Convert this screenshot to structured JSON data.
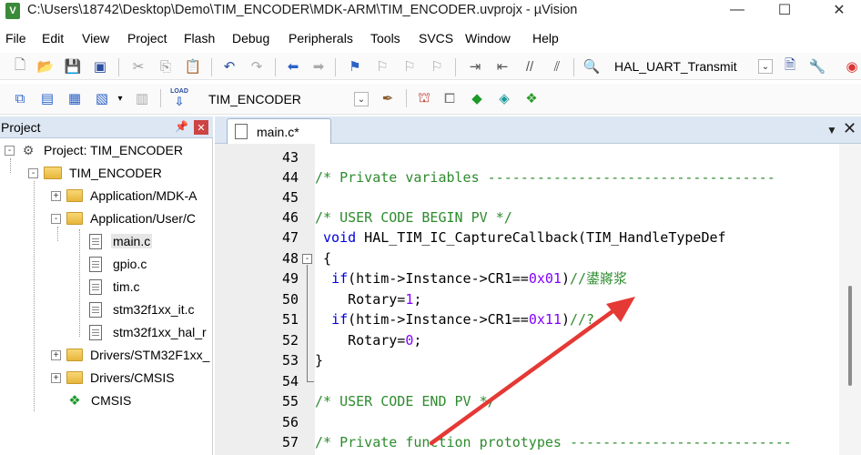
{
  "window": {
    "title": "C:\\Users\\18742\\Desktop\\Demo\\TIM_ENCODER\\MDK-ARM\\TIM_ENCODER.uvprojx - µVision",
    "app_icon": "V"
  },
  "menu": [
    "File",
    "Edit",
    "View",
    "Project",
    "Flash",
    "Debug",
    "Peripherals",
    "Tools",
    "SVCS",
    "Window",
    "Help"
  ],
  "toolbar1": {
    "find_combo_value": "HAL_UART_Transmit"
  },
  "toolbar2": {
    "target_combo_value": "TIM_ENCODER",
    "load_label": "LOAD"
  },
  "project_panel": {
    "title": "Project",
    "tree": [
      {
        "label": "Project: TIM_ENCODER",
        "type": "project",
        "expander": "-"
      },
      {
        "label": "TIM_ENCODER",
        "type": "target",
        "expander": "-"
      },
      {
        "label": "Application/MDK-A",
        "type": "folder",
        "expander": "+"
      },
      {
        "label": "Application/User/C",
        "type": "folder",
        "expander": "-"
      },
      {
        "label": "main.c",
        "type": "file",
        "selected": true
      },
      {
        "label": "gpio.c",
        "type": "file"
      },
      {
        "label": "tim.c",
        "type": "file"
      },
      {
        "label": "stm32f1xx_it.c",
        "type": "file"
      },
      {
        "label": "stm32f1xx_hal_r",
        "type": "file"
      },
      {
        "label": "Drivers/STM32F1xx_",
        "type": "folder",
        "expander": "+"
      },
      {
        "label": "Drivers/CMSIS",
        "type": "folder",
        "expander": "+"
      },
      {
        "label": "CMSIS",
        "type": "component"
      }
    ]
  },
  "editor": {
    "active_tab": "main.c*",
    "lines": [
      {
        "no": "43",
        "parts": []
      },
      {
        "no": "44",
        "parts": [
          {
            "t": "/* Private variables -----------------------------------",
            "c": "comment"
          }
        ]
      },
      {
        "no": "45",
        "parts": []
      },
      {
        "no": "46",
        "parts": [
          {
            "t": "/* USER CODE BEGIN PV */",
            "c": "comment"
          }
        ]
      },
      {
        "no": "47",
        "parts": [
          {
            "t": " ",
            "c": "plain"
          },
          {
            "t": "void",
            "c": "kw"
          },
          {
            "t": " HAL_TIM_IC_CaptureCallback(TIM_HandleTypeDef",
            "c": "plain"
          }
        ]
      },
      {
        "no": "48",
        "parts": [
          {
            "t": " {",
            "c": "plain"
          }
        ],
        "fold": "-"
      },
      {
        "no": "49",
        "parts": [
          {
            "t": "  ",
            "c": "plain"
          },
          {
            "t": "if",
            "c": "kw"
          },
          {
            "t": "(htim->Instance->CR1==",
            "c": "plain"
          },
          {
            "t": "0x01",
            "c": "num"
          },
          {
            "t": ")",
            "c": "plain"
          },
          {
            "t": "//",
            "c": "comment"
          },
          {
            "t": "鍙嶈浆",
            "c": "cjk"
          }
        ]
      },
      {
        "no": "50",
        "parts": [
          {
            "t": "    Rotary=",
            "c": "plain"
          },
          {
            "t": "1",
            "c": "num"
          },
          {
            "t": ";",
            "c": "plain"
          }
        ]
      },
      {
        "no": "51",
        "parts": [
          {
            "t": "  ",
            "c": "plain"
          },
          {
            "t": "if",
            "c": "kw"
          },
          {
            "t": "(htim->Instance->CR1==",
            "c": "plain"
          },
          {
            "t": "0x11",
            "c": "num"
          },
          {
            "t": ")",
            "c": "plain"
          },
          {
            "t": "//?",
            "c": "comment"
          }
        ]
      },
      {
        "no": "52",
        "parts": [
          {
            "t": "    Rotary=",
            "c": "plain"
          },
          {
            "t": "0",
            "c": "num"
          },
          {
            "t": ";",
            "c": "plain"
          }
        ]
      },
      {
        "no": "53",
        "parts": [
          {
            "t": "}",
            "c": "plain"
          }
        ]
      },
      {
        "no": "54",
        "parts": []
      },
      {
        "no": "55",
        "parts": [
          {
            "t": "/* USER CODE END PV */",
            "c": "comment"
          }
        ]
      },
      {
        "no": "56",
        "parts": []
      },
      {
        "no": "57",
        "parts": [
          {
            "t": "/* Private function prototypes ---------------------------",
            "c": "comment"
          }
        ]
      }
    ]
  },
  "colors": {
    "comment": "#2e8b2e",
    "keyword": "#0000dd",
    "number": "#8000ff",
    "annotation_arrow": "#e53935"
  }
}
